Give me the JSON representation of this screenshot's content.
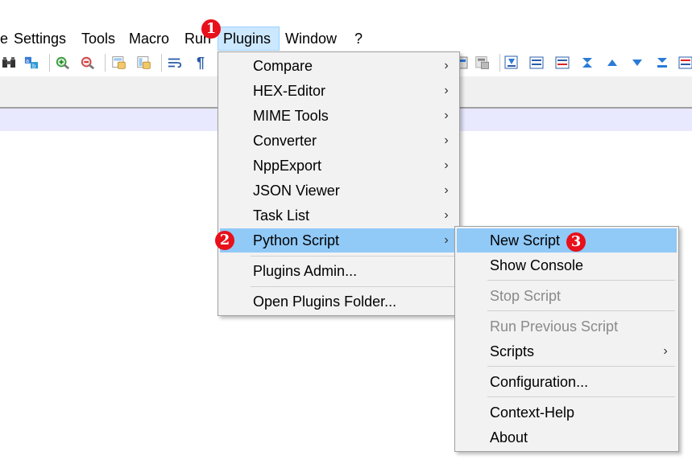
{
  "menubar": {
    "items": [
      {
        "label": "e"
      },
      {
        "label": "Settings"
      },
      {
        "label": "Tools"
      },
      {
        "label": "Macro"
      },
      {
        "label": "Run"
      },
      {
        "label": "Plugins"
      },
      {
        "label": "Window"
      },
      {
        "label": "?"
      }
    ]
  },
  "plugins_menu": {
    "items": [
      {
        "label": "Compare",
        "arrow": "›"
      },
      {
        "label": "HEX-Editor",
        "arrow": "›"
      },
      {
        "label": "MIME Tools",
        "arrow": "›"
      },
      {
        "label": "Converter",
        "arrow": "›"
      },
      {
        "label": "NppExport",
        "arrow": "›"
      },
      {
        "label": "JSON Viewer",
        "arrow": "›"
      },
      {
        "label": "Task List",
        "arrow": "›"
      },
      {
        "label": "Python Script",
        "arrow": "›"
      },
      {
        "label": "Plugins Admin..."
      },
      {
        "label": "Open Plugins Folder..."
      }
    ]
  },
  "python_script_menu": {
    "items": [
      {
        "label": "New Script"
      },
      {
        "label": "Show Console"
      },
      {
        "label": "Stop Script"
      },
      {
        "label": "Run Previous Script"
      },
      {
        "label": "Scripts",
        "arrow": "›"
      },
      {
        "label": "Configuration..."
      },
      {
        "label": "Context-Help"
      },
      {
        "label": "About"
      }
    ]
  },
  "badges": {
    "one": "1",
    "two": "2",
    "three": "3"
  },
  "toolbar": {
    "icons": [
      "binoculars-icon",
      "find-replace-icon",
      "zoom-in-icon",
      "zoom-out-icon",
      "sync-vertical-icon",
      "sync-horizontal-icon",
      "word-wrap-icon",
      "pilcrow-icon",
      "macro-record-icon",
      "macro-save-icon",
      "bookmark-icon",
      "list-icon",
      "list-red-icon",
      "collapse-icon",
      "up-triangle-icon",
      "down-triangle-icon",
      "expand-icon",
      "grid-icon"
    ],
    "pilcrow": "¶"
  },
  "colors": {
    "highlight": "#91c9f7",
    "menubar_active": "#cce8ff",
    "badge": "#e8101a",
    "line_band": "#e8e8ff"
  }
}
